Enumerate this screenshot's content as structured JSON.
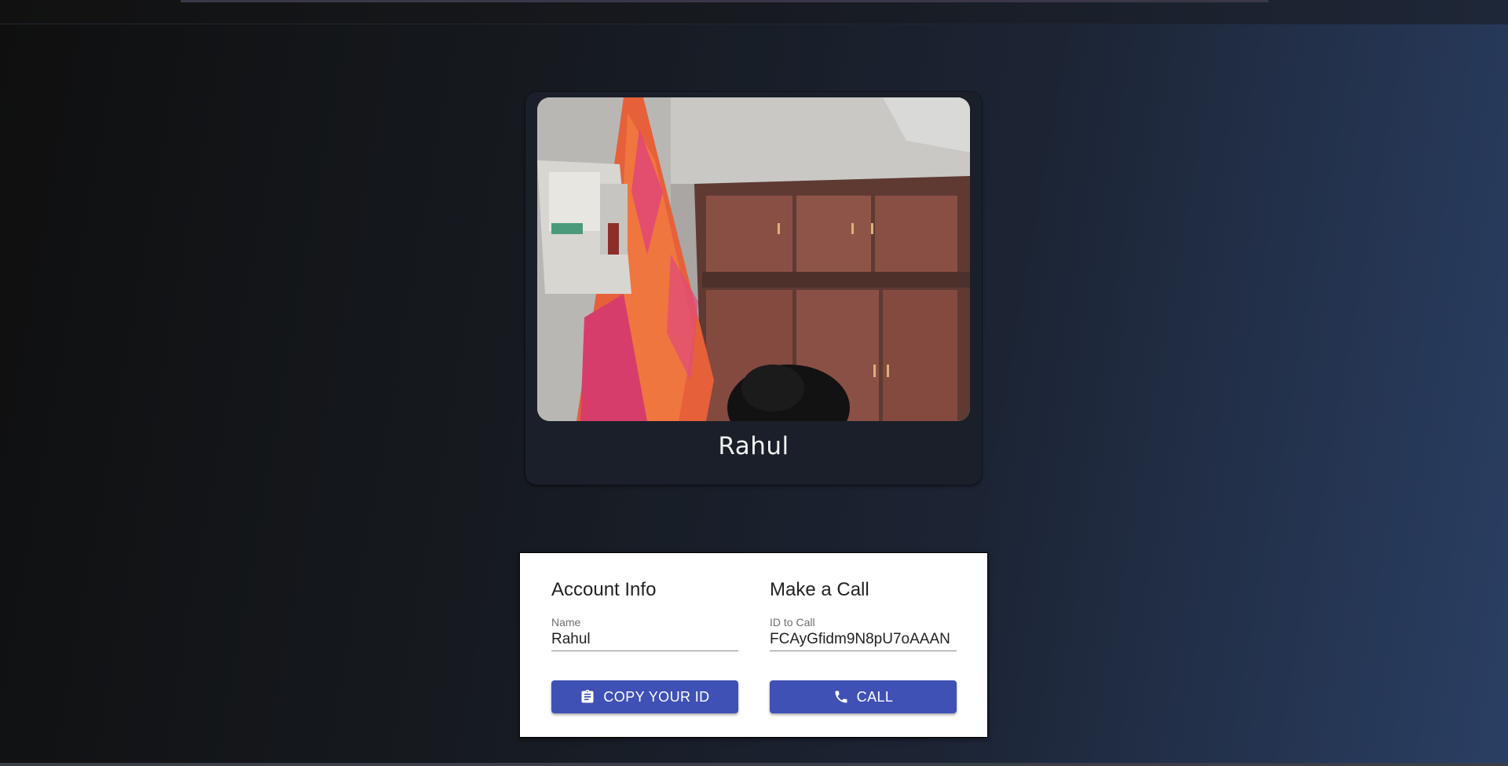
{
  "video": {
    "name": "Rahul"
  },
  "account_info": {
    "heading": "Account Info",
    "name_label": "Name",
    "name_value": "Rahul",
    "copy_button_label": "COPY YOUR ID",
    "copy_button_icon": "clipboard-icon"
  },
  "make_call": {
    "heading": "Make a Call",
    "id_label": "ID to Call",
    "id_value": "FCAyGfidm9N8pU7oAAAN",
    "call_button_label": "CALL",
    "call_button_icon": "phone-icon"
  },
  "colors": {
    "button": "#3f51b5",
    "panel": "#ffffff",
    "video_card": "#1a1f29"
  }
}
